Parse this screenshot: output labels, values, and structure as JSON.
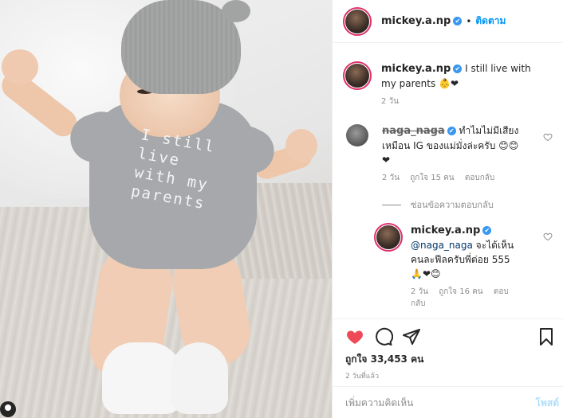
{
  "header": {
    "username": "mickey.a.np",
    "verified_icon": "✔",
    "separator": "•",
    "follow_label": "ติดตาม"
  },
  "photo": {
    "shirt_text": [
      "I still",
      "live",
      "with my",
      "parents"
    ]
  },
  "caption": {
    "username": "mickey.a.np",
    "text": "I still live with my parents 👶❤",
    "time": "2 วัน"
  },
  "comment1": {
    "username": "naga_naga",
    "text": "ทำไมไม่มีเสียงเหมือน IG ของแม่มั่งล่ะครับ 😊😊❤",
    "time": "2 วัน",
    "likes": "ถูกใจ 15 คน",
    "reply": "ตอบกลับ"
  },
  "hide_replies": "ซ่อนข้อความตอบกลับ",
  "reply1": {
    "username": "mickey.a.np",
    "mention": "@naga_naga",
    "text": " จะได้เห็นคนละฟีลครับพี่ต่อย 555🙏❤😊",
    "time": "2 วัน",
    "likes": "ถูกใจ 16 คน",
    "reply": "ตอบกลับ"
  },
  "actions": {
    "likes_text": "ถูกใจ 33,453 คน",
    "time_ago": "2 วันที่แล้ว"
  },
  "add_comment": {
    "placeholder": "เพิ่มความคิดเห็น",
    "post_label": "โพสต์"
  },
  "colors": {
    "accent": "#0095f6",
    "liked_heart": "#ed4956",
    "verified": "#3897f0"
  }
}
